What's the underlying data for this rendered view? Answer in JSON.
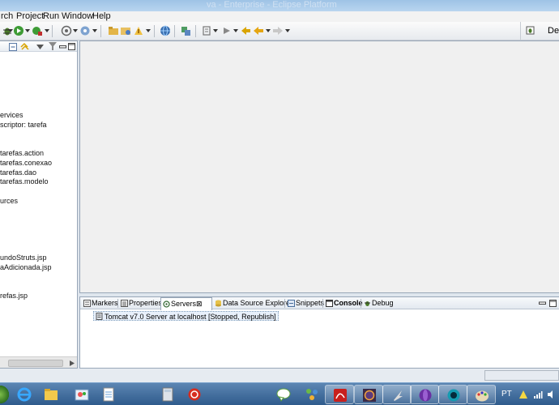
{
  "window": {
    "title": "va - Enterprise - Eclipse Platform"
  },
  "menubar": {
    "items": [
      "rch",
      "Project",
      "Run",
      "Window",
      "Help"
    ]
  },
  "toolbar": {
    "perspective_label": "Debu",
    "icons": [
      "debug-icon",
      "run-icon",
      "run-external-icon",
      "new-server-icon",
      "deploy-icon",
      "open-folder-icon",
      "open-type-icon",
      "globe-icon",
      "web-service-icon",
      "annotation-icon",
      "next-annotation-icon",
      "back-icon",
      "forward-icon"
    ]
  },
  "project_explorer": {
    "items": [
      "ervices",
      "scriptor: tarefa",
      "tarefas.action",
      "tarefas.conexao",
      "tarefas.dao",
      "tarefas.modelo",
      "urces",
      "undoStruts.jsp",
      "aAdicionada.jsp",
      "refas.jsp"
    ]
  },
  "bottom_panel": {
    "tabs": [
      {
        "label": "Markers",
        "icon": "markers-icon",
        "active": false
      },
      {
        "label": "Properties",
        "icon": "properties-icon",
        "active": false
      },
      {
        "label": "Servers",
        "icon": "servers-icon",
        "active": true,
        "close": "⊠"
      },
      {
        "label": "Data Source Explorer",
        "icon": "database-icon",
        "active": false
      },
      {
        "label": "Snippets",
        "icon": "snippets-icon",
        "active": false
      },
      {
        "label": "Console",
        "icon": "console-icon",
        "active": false
      },
      {
        "label": "Debug",
        "icon": "debug-icon",
        "active": false
      }
    ],
    "server_entry": "Tomcat v7.0 Server at localhost  [Stopped, Republish]"
  },
  "taskbar": {
    "apps": [
      "ie-icon",
      "explorer-icon",
      "paint-icon",
      "notepad-icon",
      "calculator-icon",
      "ccleaner-icon",
      "gtalk-icon",
      "network-icon",
      "acrobat-icon",
      "eclipse-icon",
      "sublime-icon",
      "orb-icon",
      "cyan-orb-icon",
      "palette-icon"
    ],
    "language": "PT"
  }
}
